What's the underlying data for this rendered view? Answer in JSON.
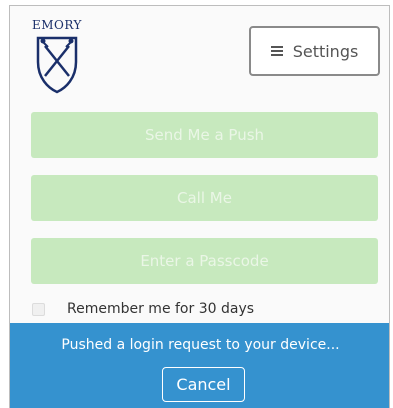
{
  "brand": {
    "logo_text": "EMORY",
    "primary_color": "#1a2f6a"
  },
  "header": {
    "settings_label": "Settings",
    "settings_icon": "hamburger-menu-icon"
  },
  "auth_options": {
    "push_label": "Send Me a Push",
    "call_label": "Call Me",
    "passcode_label": "Enter a Passcode",
    "button_color": "#c7e9be"
  },
  "remember": {
    "label": "Remember me for 30 days",
    "checked": false
  },
  "status": {
    "message": "Pushed a login request to your device...",
    "cancel_label": "Cancel",
    "bar_color": "#3592cf"
  }
}
